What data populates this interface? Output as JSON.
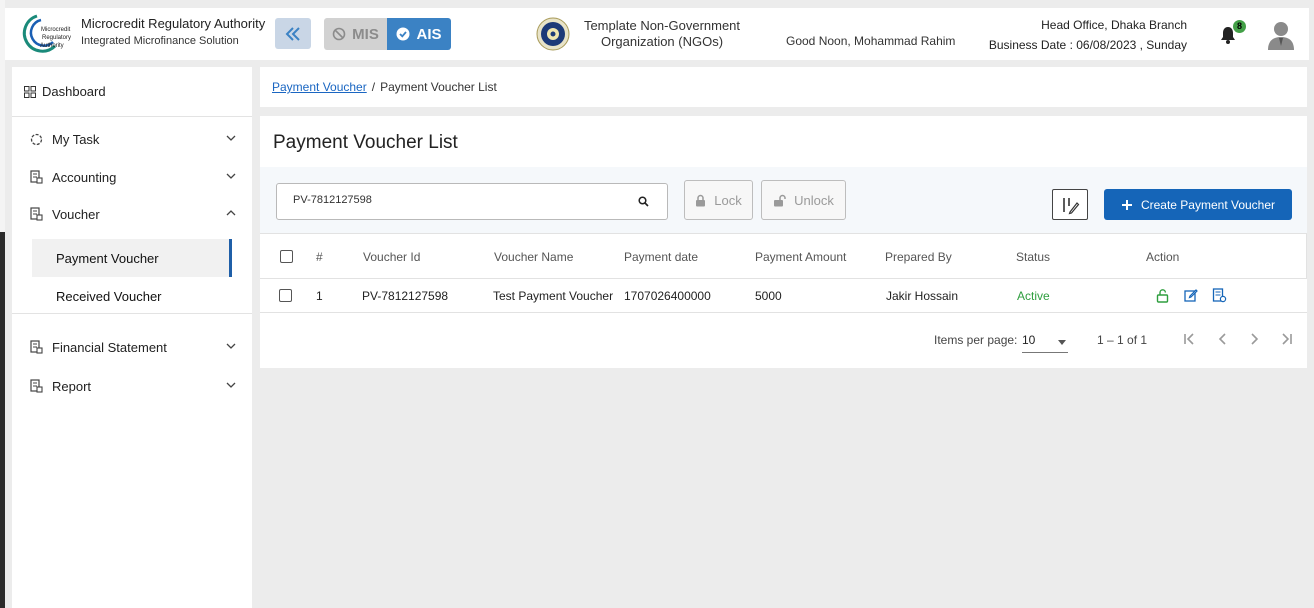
{
  "header": {
    "brand_title": "Microcredit Regulatory Authority",
    "brand_subtitle": "Integrated Microfinance Solution",
    "logo_text_1": "Microcredit",
    "logo_text_2": "Regulatory",
    "logo_text_3": "Authority",
    "mode_mis": "MIS",
    "mode_ais": "AIS",
    "org_name": "Template Non-Government Organization (NGOs)",
    "greeting": "Good Noon, Mohammad Rahim",
    "branch": "Head Office, Dhaka Branch",
    "business_date": "Business Date : 06/08/2023 , Sunday",
    "notification_count": "8"
  },
  "sidebar": {
    "dashboard": "Dashboard",
    "my_task": "My Task",
    "accounting": "Accounting",
    "voucher": "Voucher",
    "payment_voucher": "Payment Voucher",
    "received_voucher": "Received Voucher",
    "financial_statement": "Financial Statement",
    "report": "Report"
  },
  "breadcrumb": {
    "parent": "Payment Voucher",
    "separator": "/",
    "current": "Payment Voucher List"
  },
  "page": {
    "title": "Payment Voucher List",
    "search_value": "PV-7812127598",
    "lock_label": "Lock",
    "unlock_label": "Unlock",
    "create_label": "Create Payment Voucher"
  },
  "table": {
    "headers": {
      "index": "#",
      "voucher_id": "Voucher Id",
      "voucher_name": "Voucher Name",
      "payment_date": "Payment date",
      "payment_amount": "Payment Amount",
      "prepared_by": "Prepared By",
      "status": "Status",
      "action": "Action"
    },
    "rows": [
      {
        "index": "1",
        "voucher_id": "PV-7812127598",
        "voucher_name": "Test Payment Voucher",
        "payment_date": "1707026400000",
        "payment_amount": "5000",
        "prepared_by": "Jakir Hossain",
        "status": "Active"
      }
    ]
  },
  "paginator": {
    "items_per_page_label": "Items per page:",
    "page_size": "10",
    "range": "1 – 1 of 1"
  },
  "colors": {
    "primary": "#1565b8",
    "ais_active": "#3b82c4",
    "status_active": "#2e9e3e",
    "badge": "#43a047"
  }
}
